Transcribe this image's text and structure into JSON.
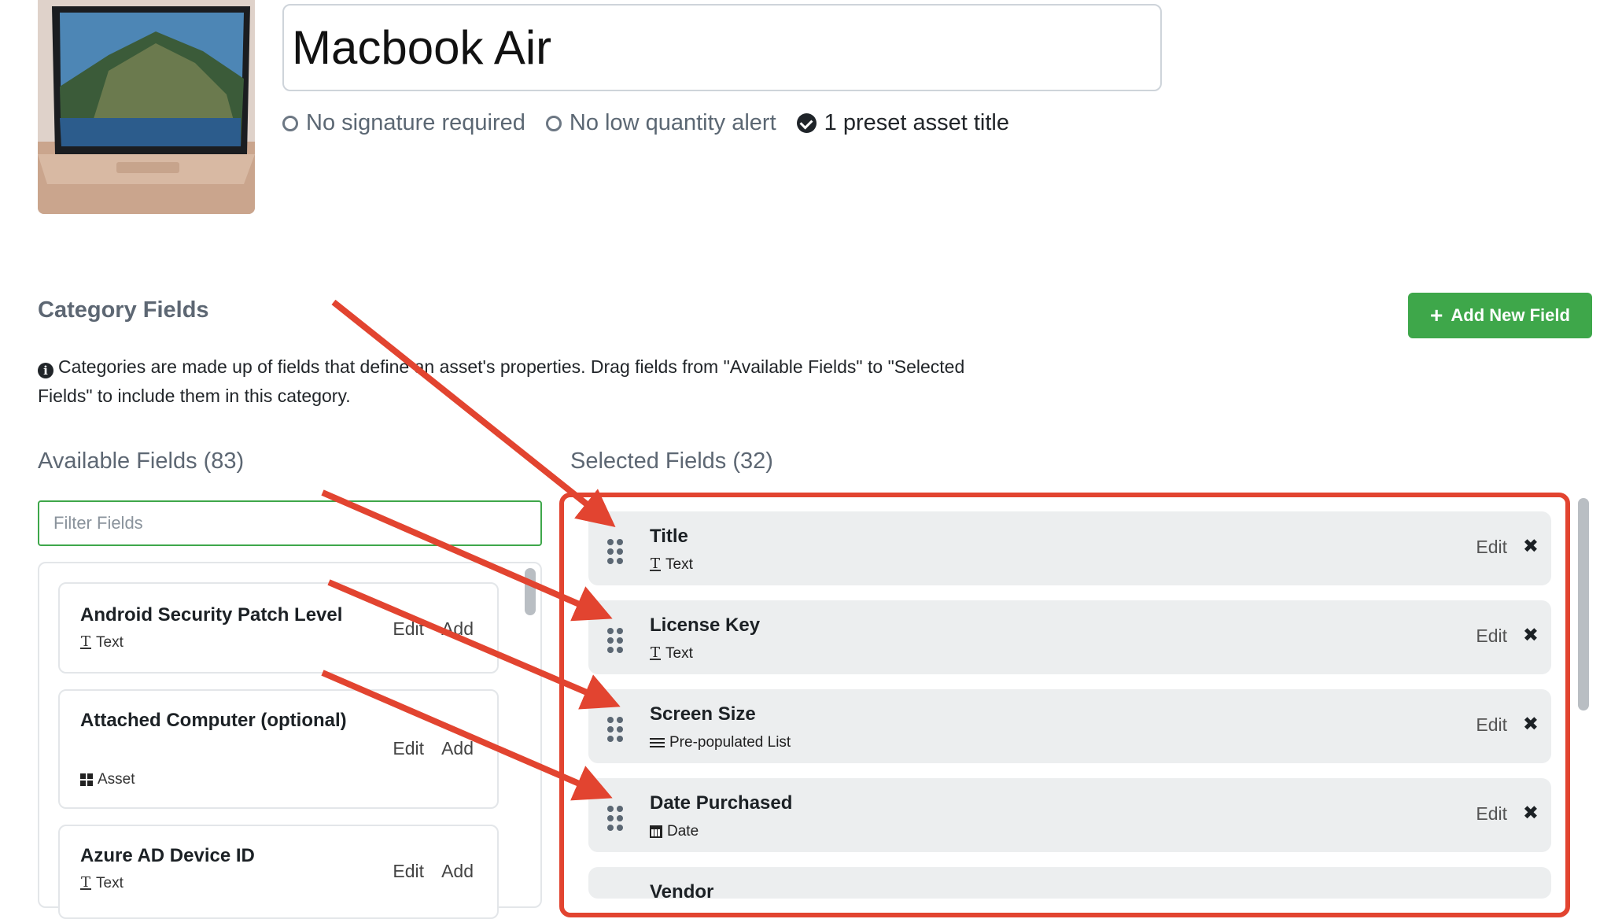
{
  "asset": {
    "title": "Macbook Air",
    "flags": [
      {
        "label": "No signature required",
        "state": "off"
      },
      {
        "label": "No low quantity alert",
        "state": "off"
      },
      {
        "label": "1 preset asset title",
        "state": "on"
      }
    ]
  },
  "category": {
    "section_title": "Category Fields",
    "add_button_label": "Add New Field",
    "info_text": "Categories are made up of fields that define an asset's properties. Drag fields from \"Available Fields\" to \"Selected Fields\" to include them in this category."
  },
  "available": {
    "title": "Available Fields (83)",
    "filter_placeholder": "Filter Fields",
    "edit_label": "Edit",
    "add_label": "Add",
    "items": [
      {
        "name": "Android Security Patch Level",
        "type": "Text",
        "icon": "text-icon"
      },
      {
        "name": "Attached Computer (optional)",
        "type": "Asset",
        "icon": "asset-grid-icon"
      },
      {
        "name": "Azure AD Device ID",
        "type": "Text",
        "icon": "text-icon"
      }
    ]
  },
  "selected": {
    "title": "Selected Fields (32)",
    "edit_label": "Edit",
    "remove_symbol": "✖",
    "items": [
      {
        "name": "Title",
        "type": "Text",
        "icon": "text-icon"
      },
      {
        "name": "License Key",
        "type": "Text",
        "icon": "text-icon"
      },
      {
        "name": "Screen Size",
        "type": "Pre-populated List",
        "icon": "list-icon"
      },
      {
        "name": "Date Purchased",
        "type": "Date",
        "icon": "calendar-icon"
      },
      {
        "name": "Vendor",
        "type": "",
        "icon": ""
      }
    ]
  },
  "colors": {
    "primary_green": "#3ea74a",
    "annotation_red": "#e24430",
    "muted_heading": "#5d6773"
  }
}
